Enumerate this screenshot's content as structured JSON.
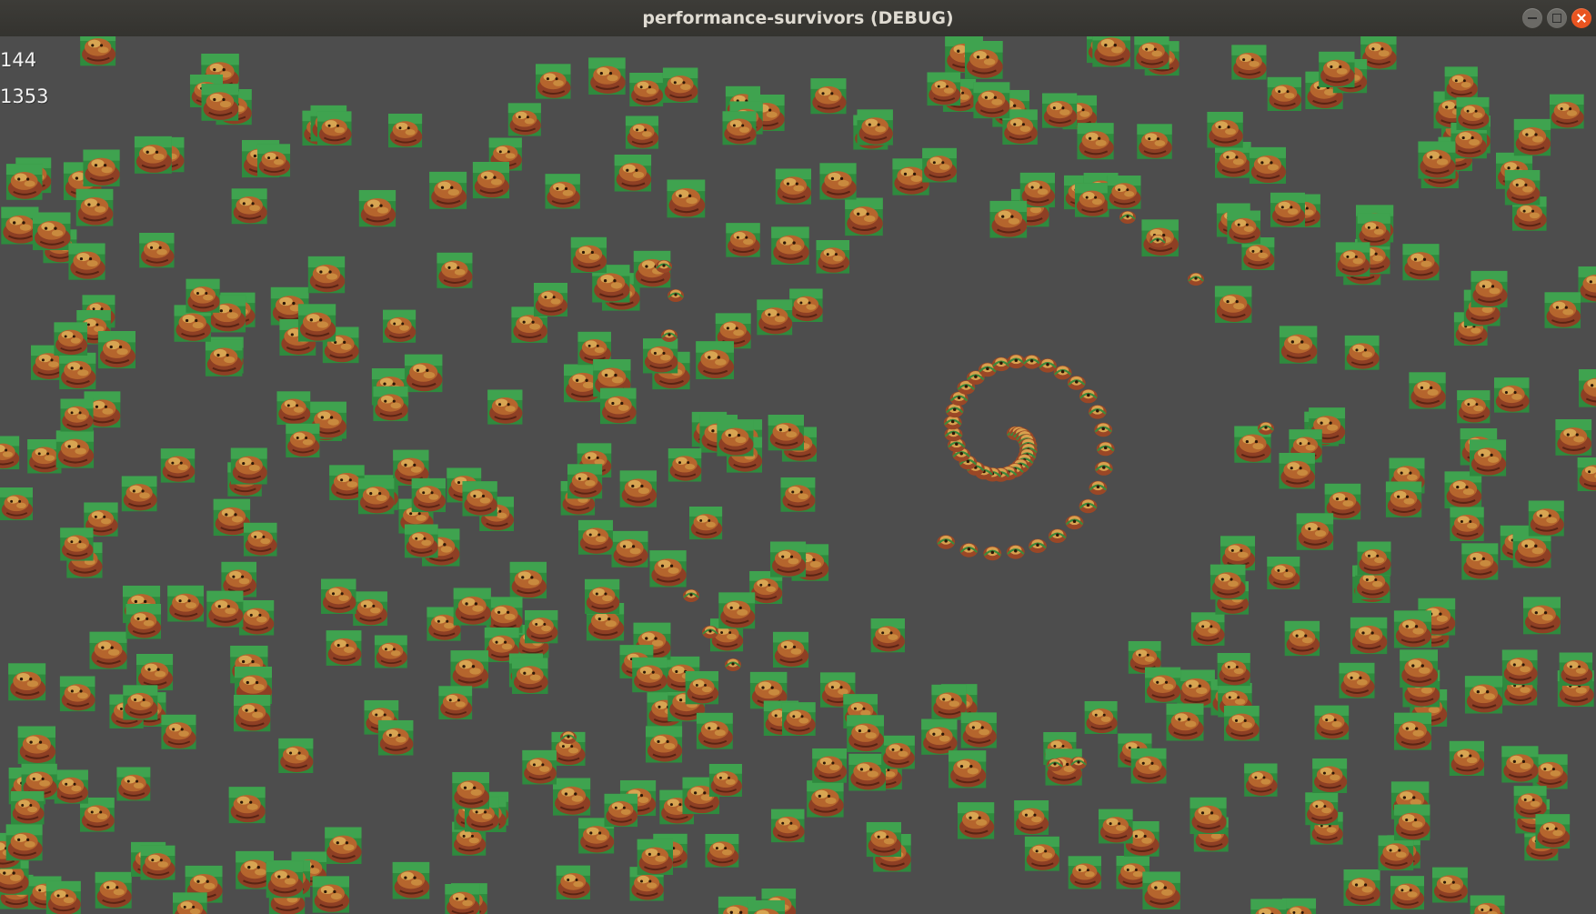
{
  "window": {
    "title": "performance-survivors (DEBUG)"
  },
  "hud": {
    "fps": "144",
    "entity_count": "1353"
  },
  "colors": {
    "background": "#4d4d4d",
    "titlebar": "#3a3935",
    "close_button": "#e95420"
  },
  "icons": {
    "enemy": "enemy-sprite-icon",
    "projectile": "projectile-icon"
  }
}
